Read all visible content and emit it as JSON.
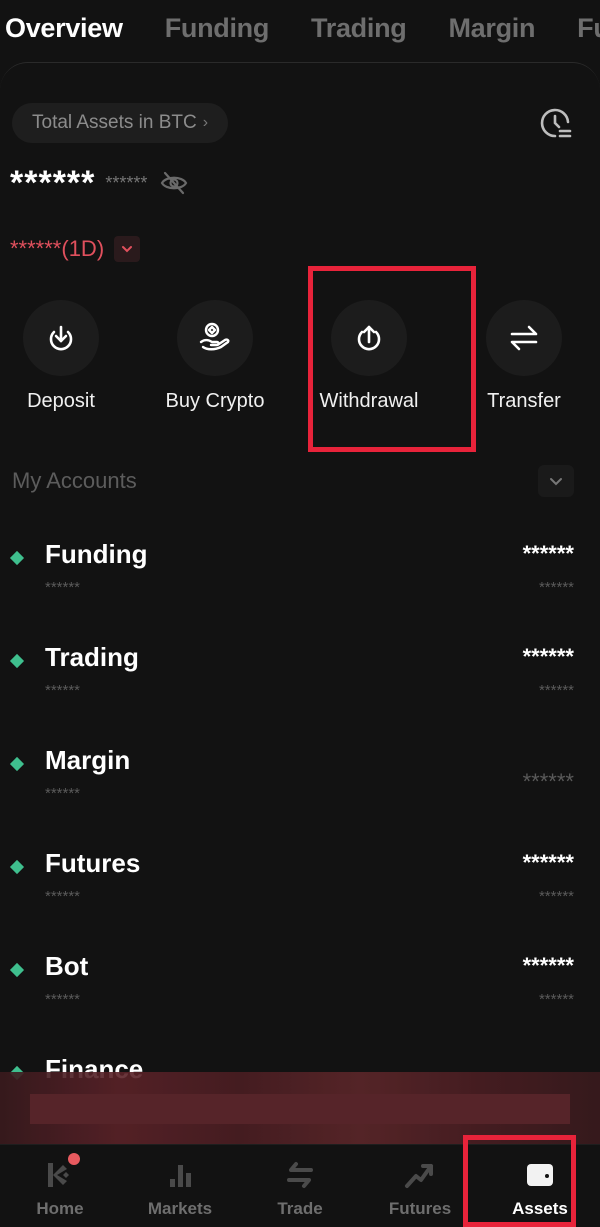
{
  "top_tabs": [
    {
      "label": "Overview",
      "active": true
    },
    {
      "label": "Funding",
      "active": false
    },
    {
      "label": "Trading",
      "active": false
    },
    {
      "label": "Margin",
      "active": false
    },
    {
      "label": "Futures",
      "active": false
    }
  ],
  "summary": {
    "asset_selector_label": "Total Assets in BTC",
    "asset_selector_chevron": "›",
    "history_icon": "clock-list-icon",
    "balance_main": "******",
    "balance_sub": "******",
    "visibility_icon": "eye-off-icon",
    "pnl_text": "******(1D)",
    "pnl_color": "#e0505d"
  },
  "actions": [
    {
      "label": "Deposit",
      "icon": "download-circle-icon"
    },
    {
      "label": "Buy Crypto",
      "icon": "coin-hand-icon"
    },
    {
      "label": "Withdrawal",
      "icon": "upload-circle-icon",
      "highlighted": true
    },
    {
      "label": "Transfer",
      "icon": "swap-arrows-icon"
    }
  ],
  "accounts_section": {
    "title": "My Accounts",
    "toggle_icon": "chevron-down-icon"
  },
  "accounts": [
    {
      "name": "Funding",
      "name_sub": "******",
      "value": "******",
      "value_sub": "******"
    },
    {
      "name": "Trading",
      "name_sub": "******",
      "value": "******",
      "value_sub": "******"
    },
    {
      "name": "Margin",
      "name_sub": "******",
      "value": "******",
      "value_sub": ""
    },
    {
      "name": "Futures",
      "name_sub": "******",
      "value": "******",
      "value_sub": "******"
    },
    {
      "name": "Bot",
      "name_sub": "******",
      "value": "******",
      "value_sub": "******"
    },
    {
      "name": "Finance",
      "name_sub": "",
      "value": "",
      "value_sub": ""
    }
  ],
  "bottom_nav": [
    {
      "label": "Home",
      "icon": "kucoin-logo-icon",
      "notification": true
    },
    {
      "label": "Markets",
      "icon": "bar-chart-icon"
    },
    {
      "label": "Trade",
      "icon": "swap-vertical-icon"
    },
    {
      "label": "Futures",
      "icon": "trend-up-icon"
    },
    {
      "label": "Assets",
      "icon": "wallet-icon",
      "active": true,
      "highlighted": true
    }
  ],
  "colors": {
    "background": "#121212",
    "accent_green": "#3fbf8e",
    "highlight_red": "#e8233a",
    "pnl_red": "#e0505d"
  }
}
